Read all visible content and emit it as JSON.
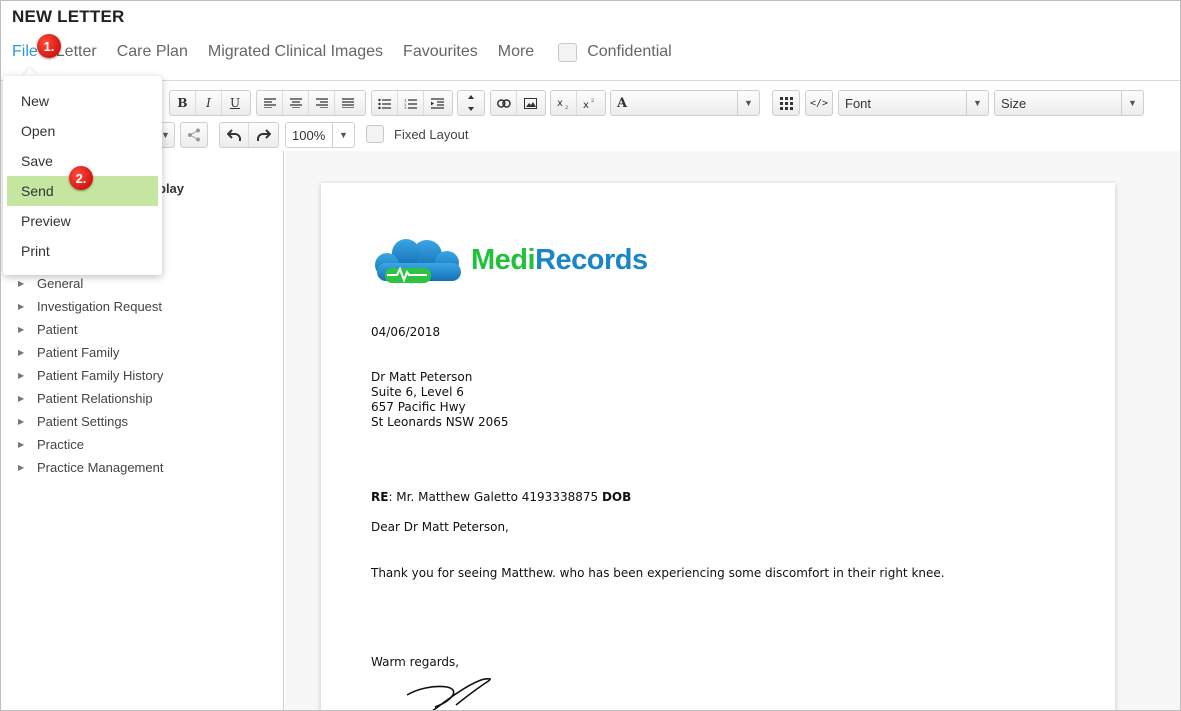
{
  "window": {
    "title": "NEW LETTER"
  },
  "menubar": {
    "file": "File",
    "letter": "Letter",
    "care_plan": "Care Plan",
    "migrated": "Migrated Clinical Images",
    "favourites": "Favourites",
    "more": "More",
    "confidential": "Confidential"
  },
  "file_menu": {
    "items": [
      "New",
      "Open",
      "Save",
      "Send",
      "Preview",
      "Print"
    ]
  },
  "badges": {
    "step1": "1.",
    "step2": "2."
  },
  "toolbar": {
    "bold": "B",
    "italic": "I",
    "underline": "U",
    "font_color_glyph": "A",
    "font_label": "Font",
    "size_label": "Size",
    "zoom": "100%",
    "fixed_layout": "Fixed Layout"
  },
  "left": {
    "partial_heading": "play",
    "tree": [
      "General",
      "Investigation Request",
      "Patient",
      "Patient Family",
      "Patient Family History",
      "Patient Relationship",
      "Patient Settings",
      "Practice",
      "Practice Management"
    ]
  },
  "letter": {
    "brand_medi": "Medi",
    "brand_records": "Records",
    "date": "04/06/2018",
    "address": [
      "Dr Matt Peterson",
      "Suite 6, Level 6",
      "657 Pacific Hwy",
      "St Leonards NSW 2065"
    ],
    "re_label": "RE",
    "re_text": ": Mr. Matthew Galetto 4193338875 ",
    "dob_label": "DOB",
    "greeting": "Dear Dr Matt Peterson,",
    "body": "Thank you for seeing Matthew. who has been experiencing some discomfort in their right knee.",
    "closing": "Warm regards,"
  },
  "colors": {
    "accent": "#2d9ad6",
    "highlight": "#c4e6a0",
    "badge": "#d80000",
    "brand_green": "#22c13a",
    "brand_blue": "#1a86c8"
  }
}
